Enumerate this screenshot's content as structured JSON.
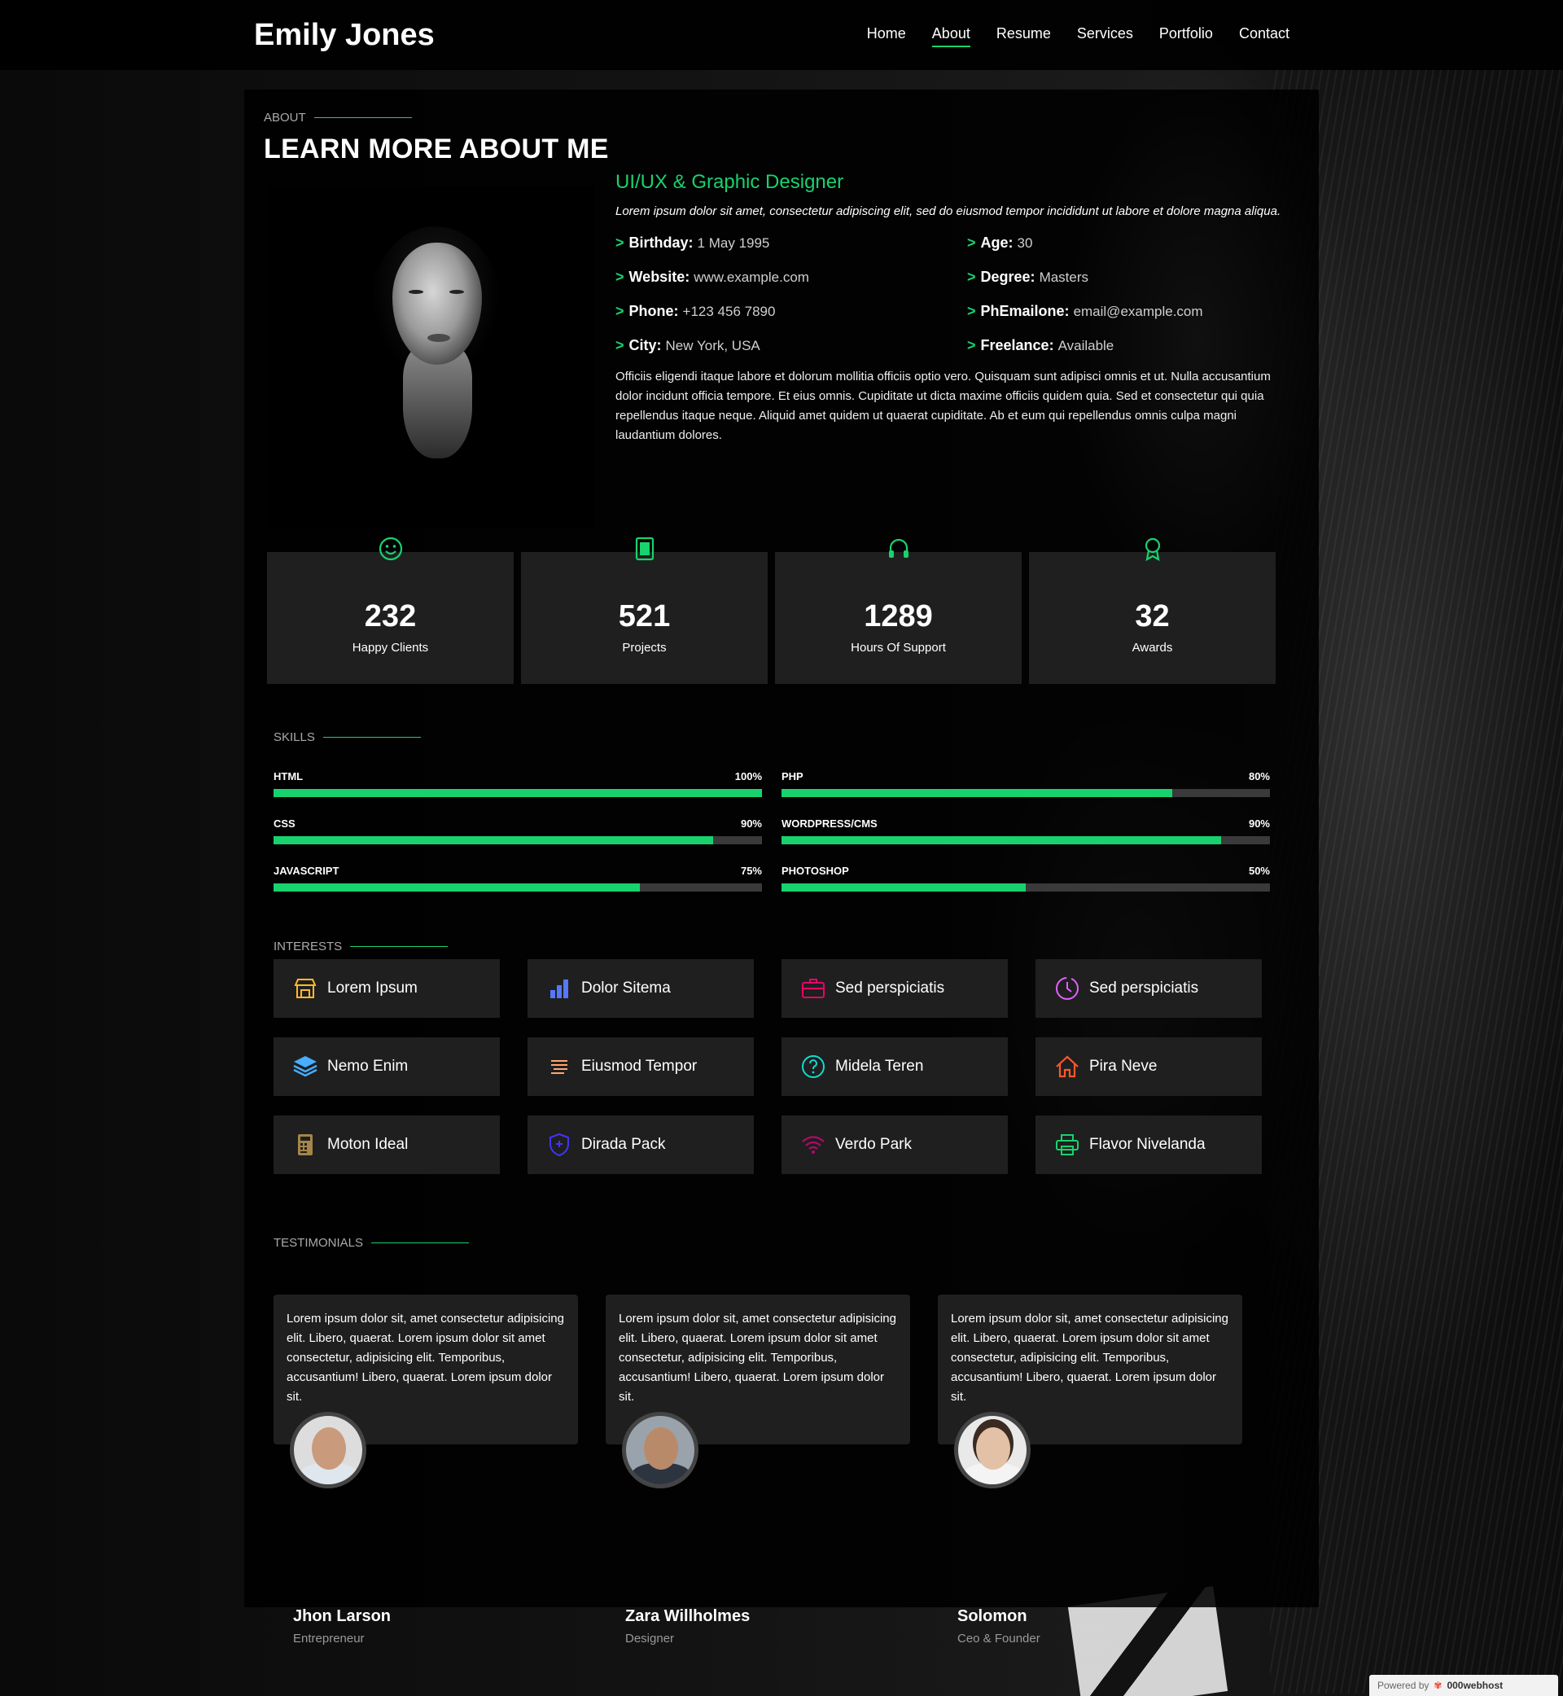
{
  "header": {
    "logo": "Emily Jones",
    "nav": [
      "Home",
      "About",
      "Resume",
      "Services",
      "Portfolio",
      "Contact"
    ],
    "active": "About"
  },
  "about": {
    "label": "About",
    "title": "LEARN MORE ABOUT ME",
    "role": "UI/UX & Graphic Designer",
    "lead": "Lorem ipsum dolor sit amet, consectetur adipiscing elit, sed do eiusmod tempor incididunt ut labore et dolore magna aliqua.",
    "facts": [
      {
        "key": "Birthday:",
        "value": "1 May 1995"
      },
      {
        "key": "Age:",
        "value": "30"
      },
      {
        "key": "Website:",
        "value": "www.example.com"
      },
      {
        "key": "Degree:",
        "value": "Masters"
      },
      {
        "key": "Phone:",
        "value": "+123 456 7890"
      },
      {
        "key": "PhEmailone:",
        "value": "email@example.com"
      },
      {
        "key": "City:",
        "value": "New York, USA"
      },
      {
        "key": "Freelance:",
        "value": "Available"
      }
    ],
    "description": "Officiis eligendi itaque labore et dolorum mollitia officiis optio vero. Quisquam sunt adipisci omnis et ut. Nulla accusantium dolor incidunt officia tempore. Et eius omnis. Cupiditate ut dicta maxime officiis quidem quia. Sed et consectetur qui quia repellendus itaque neque. Aliquid amet quidem ut quaerat cupiditate. Ab et eum qui repellendus omnis culpa magni laudantium dolores."
  },
  "counts": [
    {
      "icon": "smiley-icon",
      "value": "232",
      "label": "Happy Clients"
    },
    {
      "icon": "journal-icon",
      "value": "521",
      "label": "Projects"
    },
    {
      "icon": "headset-icon",
      "value": "1289",
      "label": "Hours Of Support"
    },
    {
      "icon": "award-icon",
      "value": "32",
      "label": "Awards"
    }
  ],
  "skills": {
    "label": "Skills",
    "items": [
      {
        "name": "HTML",
        "percent_label": "100%",
        "percent": 100
      },
      {
        "name": "PHP",
        "percent_label": "80%",
        "percent": 80
      },
      {
        "name": "CSS",
        "percent_label": "90%",
        "percent": 90
      },
      {
        "name": "WORDPRESS/CMS",
        "percent_label": "90%",
        "percent": 90
      },
      {
        "name": "JAVASCRIPT",
        "percent_label": "75%",
        "percent": 75
      },
      {
        "name": "PHOTOSHOP",
        "percent_label": "50%",
        "percent": 50
      }
    ]
  },
  "interests": {
    "label": "Interests",
    "items": [
      {
        "icon": "store-icon",
        "label": "Lorem Ipsum",
        "color": "#ffbb2c"
      },
      {
        "icon": "bar-chart-icon",
        "label": "Dolor Sitema",
        "color": "#5578ff"
      },
      {
        "icon": "briefcase-icon",
        "label": "Sed perspiciatis",
        "color": "#e80368"
      },
      {
        "icon": "clock-icon",
        "label": "Sed perspiciatis",
        "color": "#e361ff"
      },
      {
        "icon": "layers-icon",
        "label": "Nemo Enim",
        "color": "#47aeff"
      },
      {
        "icon": "list-icon",
        "label": "Eiusmod Tempor",
        "color": "#ffa76e"
      },
      {
        "icon": "question-icon",
        "label": "Midela Teren",
        "color": "#11dbcf"
      },
      {
        "icon": "home-icon",
        "label": "Pira Neve",
        "color": "#ff5828"
      },
      {
        "icon": "calculator-icon",
        "label": "Moton Ideal",
        "color": "#b2904f"
      },
      {
        "icon": "shield-icon",
        "label": "Dirada Pack",
        "color": "#4233ff"
      },
      {
        "icon": "wifi-icon",
        "label": "Verdo Park",
        "color": "#b20969"
      },
      {
        "icon": "printer-icon",
        "label": "Flavor Nivelanda",
        "color": "#18d26e"
      }
    ]
  },
  "testimonials": {
    "label": "Testimonials",
    "items": [
      {
        "text": "Lorem ipsum dolor sit, amet consectetur adipisicing elit. Libero, quaerat. Lorem ipsum dolor sit amet consectetur, adipisicing elit. Temporibus, accusantium! Libero, quaerat. Lorem ipsum dolor sit.",
        "name": "Jhon Larson",
        "role": "Entrepreneur"
      },
      {
        "text": "Lorem ipsum dolor sit, amet consectetur adipisicing elit. Libero, quaerat. Lorem ipsum dolor sit amet consectetur, adipisicing elit. Temporibus, accusantium! Libero, quaerat. Lorem ipsum dolor sit.",
        "name": "Zara Willholmes",
        "role": "Designer"
      },
      {
        "text": "Lorem ipsum dolor sit, amet consectetur adipisicing elit. Libero, quaerat. Lorem ipsum dolor sit amet consectetur, adipisicing elit. Temporibus, accusantium! Libero, quaerat. Lorem ipsum dolor sit.",
        "name": "Solomon",
        "role": "Ceo & Founder"
      }
    ]
  },
  "footer_badge": {
    "prefix": "Powered by",
    "brand": "000webhost"
  },
  "colors": {
    "accent": "#18d26e",
    "card": "#1f1f1f",
    "panel": "#000000"
  }
}
